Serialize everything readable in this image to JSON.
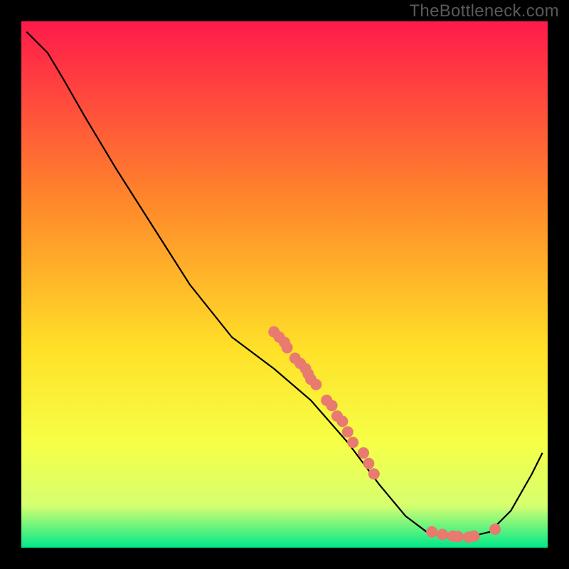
{
  "watermark": "TheBottleneck.com",
  "colors": {
    "black": "#000000",
    "curve": "#000000",
    "dot_fill": "#e87a6f",
    "dot_stroke": "#c95a50",
    "grad_top": "#ff1a4b",
    "grad_mid1": "#ff6a2f",
    "grad_mid2": "#ffd225",
    "grad_mid3": "#f7ff3a",
    "grad_bottom": "#00e88a"
  },
  "chart_data": {
    "type": "line",
    "title": "",
    "xlabel": "",
    "ylabel": "",
    "xlim": [
      0,
      100
    ],
    "ylim": [
      0,
      100
    ],
    "curve": [
      {
        "x": 1,
        "y": 98
      },
      {
        "x": 5,
        "y": 94
      },
      {
        "x": 8,
        "y": 89
      },
      {
        "x": 12,
        "y": 82
      },
      {
        "x": 18,
        "y": 72
      },
      {
        "x": 25,
        "y": 61
      },
      {
        "x": 32,
        "y": 50
      },
      {
        "x": 40,
        "y": 40
      },
      {
        "x": 48,
        "y": 34
      },
      {
        "x": 55,
        "y": 28
      },
      {
        "x": 62,
        "y": 20
      },
      {
        "x": 68,
        "y": 12
      },
      {
        "x": 73,
        "y": 6
      },
      {
        "x": 77,
        "y": 3
      },
      {
        "x": 81,
        "y": 2
      },
      {
        "x": 85,
        "y": 2
      },
      {
        "x": 89,
        "y": 3
      },
      {
        "x": 93,
        "y": 7
      },
      {
        "x": 97,
        "y": 14
      },
      {
        "x": 99,
        "y": 18
      }
    ],
    "points": [
      {
        "x": 48,
        "y": 41
      },
      {
        "x": 49,
        "y": 40
      },
      {
        "x": 50,
        "y": 39
      },
      {
        "x": 50.5,
        "y": 38
      },
      {
        "x": 52,
        "y": 36
      },
      {
        "x": 53,
        "y": 35
      },
      {
        "x": 54,
        "y": 34
      },
      {
        "x": 54.5,
        "y": 33
      },
      {
        "x": 55,
        "y": 32
      },
      {
        "x": 56,
        "y": 31
      },
      {
        "x": 58,
        "y": 28
      },
      {
        "x": 59,
        "y": 27
      },
      {
        "x": 60,
        "y": 25
      },
      {
        "x": 61,
        "y": 24
      },
      {
        "x": 62,
        "y": 22
      },
      {
        "x": 63,
        "y": 20
      },
      {
        "x": 65,
        "y": 18
      },
      {
        "x": 66,
        "y": 16
      },
      {
        "x": 67,
        "y": 14
      },
      {
        "x": 78,
        "y": 3
      },
      {
        "x": 80,
        "y": 2.5
      },
      {
        "x": 82,
        "y": 2.2
      },
      {
        "x": 83,
        "y": 2.1
      },
      {
        "x": 85,
        "y": 2.0
      },
      {
        "x": 86,
        "y": 2.2
      },
      {
        "x": 90,
        "y": 3.5
      }
    ]
  }
}
